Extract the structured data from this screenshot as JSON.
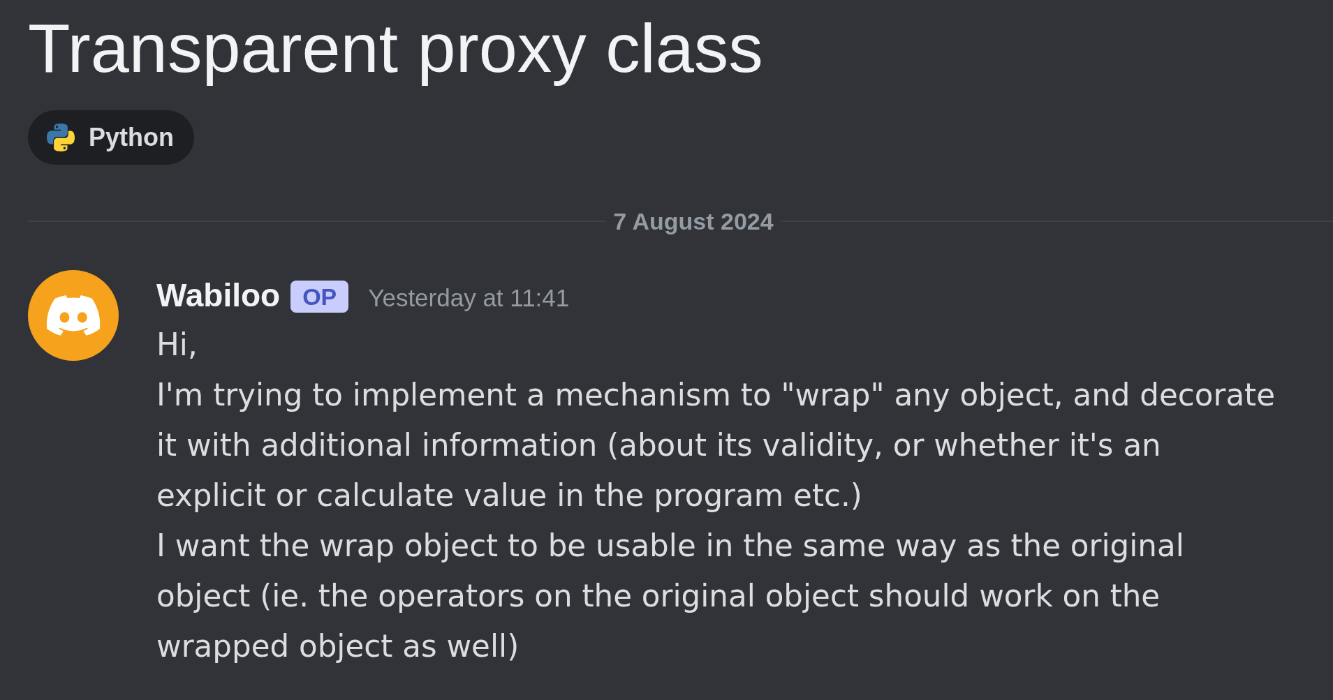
{
  "post": {
    "title": "Transparent proxy class",
    "tags": [
      {
        "label": "Python"
      }
    ]
  },
  "divider": {
    "date": "7 August 2024"
  },
  "messages": [
    {
      "author": "Wabiloo",
      "badge": "OP",
      "timestamp": "Yesterday at 11:41",
      "text": "Hi,\nI'm trying to implement a mechanism to \"wrap\" any object, and decorate it with additional information (about its validity, or whether it's an explicit or calculate value in the program etc.)\nI want the wrap object to be usable in the same way as the original object (ie. the operators on the original object should work on the wrapped object as well)"
    }
  ]
}
